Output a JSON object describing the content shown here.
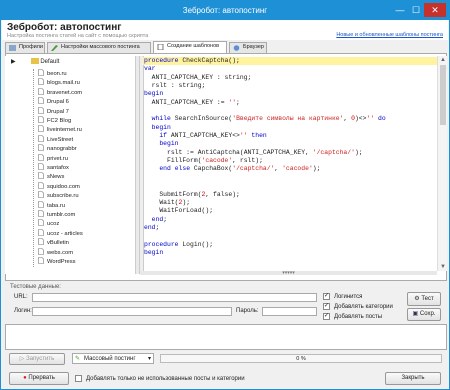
{
  "window": {
    "title": "Зебробот: автопостинг",
    "min": "—",
    "max": "☐",
    "close": "✕"
  },
  "header": {
    "title": "Зебробот: автопостинг",
    "subtitle": "Настройка постинга статей на сайт с помощью скрипта",
    "link": "Новые и обновленные шаблоны постинга"
  },
  "tabs": [
    "Профили",
    "Настройки массового постинга",
    "Создание шаблонов",
    "Браузер"
  ],
  "tree": {
    "root": "Default",
    "items": [
      "beon.ru",
      "blogs.mail.ru",
      "bravenet.com",
      "Drupal 6",
      "Drupal 7",
      "FC2 Blog",
      "liveinternet.ru",
      "LiveStreet",
      "nanograbbr",
      "privet.ru",
      "santafox",
      "sNews",
      "squidoo.com",
      "subscribe.ru",
      "taba.ru",
      "tumblr.com",
      "ucoz",
      "ucoz - articles",
      "vBulletin",
      "webs.com",
      "WordPress"
    ]
  },
  "code_lines": [
    "procedure CheckCaptcha();",
    "var",
    "  ANTI_CAPTCHA_KEY : string;",
    "  rslt : string;",
    "begin",
    "  ANTI_CAPTCHA_KEY := '';",
    "",
    "  while SearchInSource('Введите символы на картинке', 0)<>'' do",
    "  begin",
    "    if ANTI_CAPTCHA_KEY<>'' then",
    "    begin",
    "      rslt := AntiCaptcha(ANTI_CAPTCHA_KEY, '/captcha/');",
    "      FillForm('cacode', rslt);",
    "    end else CapchaBox('/captcha/', 'cacode');",
    "",
    "",
    "    SubmitForm(2, false);",
    "    Wait(2);",
    "    WaitForLoad();",
    "  end;",
    "end;",
    "",
    "procedure Login();",
    "begin"
  ],
  "test": {
    "title": "Тестовые данные:",
    "url_label": "URL:",
    "login_label": "Логин:",
    "password_label": "Пароль:",
    "url_value": "",
    "login_value": "",
    "password_value": "",
    "checkboxes": [
      "Логинится",
      "Добавлять категории",
      "Добавлять посты"
    ],
    "test_button": "Тест",
    "save_button": "Сохр."
  },
  "status": {
    "run_button": "Запустить",
    "mode": "Массовый постинг",
    "progress": "0 %",
    "progress_value": 0
  },
  "footer": {
    "stop_button": "Прервать",
    "only_unused": "Добавлять только не использованные посты и категории",
    "close_button": "Закрыть"
  },
  "colors": {
    "titlebar": "#1e90d6",
    "close": "#c7312b",
    "link": "#1a55c9",
    "highlight": "#fff3a0"
  }
}
